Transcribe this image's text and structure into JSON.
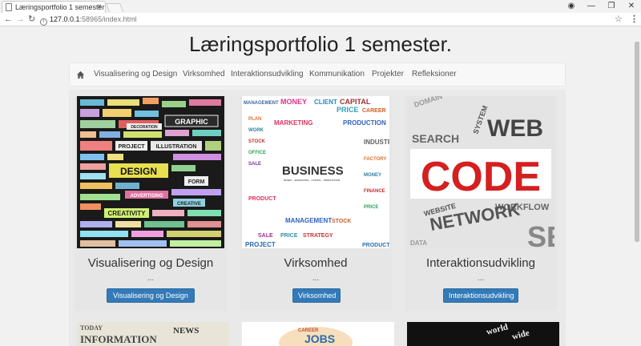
{
  "browser": {
    "tab_title": "Læringsportfolio 1 semester",
    "tab_close": "×",
    "url_host": "127.0.0.1",
    "url_rest": ":58965/index.html",
    "back": "←",
    "forward": "→",
    "reload": "↻",
    "star": "☆",
    "menu": "⋮",
    "minimize": "—",
    "maximize": "❐",
    "close": "✕",
    "profile": "◉"
  },
  "page": {
    "title": "Læringsportfolio 1 semester."
  },
  "nav": {
    "items": [
      "Visualisering og Design",
      "Virksomhed",
      "Interaktionsudvikling",
      "Kommunikation",
      "Projekter",
      "Refleksioner"
    ]
  },
  "cards": [
    {
      "title": "Visualisering og Design",
      "dots": "...",
      "button": "Visualisering og Design",
      "image_words": [
        "GRAPHIC",
        "DESIGN",
        "PROJECT",
        "ILLUSTRATION",
        "FORM",
        "CREATIVITY",
        "ADVERTISING",
        "DECORATION",
        "CREATIVE"
      ]
    },
    {
      "title": "Virksomhed",
      "dots": "...",
      "button": "Virksomhed",
      "image_words": [
        "BUSINESS",
        "MONEY",
        "CAPITAL",
        "PRICE",
        "MARKETING",
        "PRODUCTION",
        "MANAGEMENT",
        "PROJECT",
        "INDUSTRY",
        "CLIENT"
      ]
    },
    {
      "title": "Interaktionsudvikling",
      "dots": "...",
      "button": "Interaktionsudvikling",
      "image_words": [
        "CODE",
        "WEB",
        "SEARCH",
        "NETWORK",
        "WEBSITE",
        "WORKFLOW",
        "SYSTEM",
        "DOMAIN"
      ]
    }
  ],
  "row2_words": [
    [
      "INFORMATION",
      "NEWS",
      "TODAY"
    ],
    [
      "JOBS",
      "CAREER"
    ],
    [
      "world",
      "wide"
    ]
  ]
}
